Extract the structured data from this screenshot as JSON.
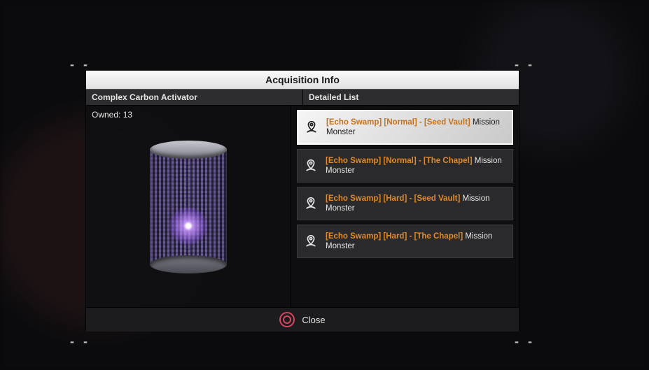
{
  "panel": {
    "title": "Acquisition Info",
    "item_header": "Complex Carbon Activator",
    "list_header": "Detailed List",
    "owned_label": "Owned:",
    "owned_count": 13,
    "close_label": "Close"
  },
  "entries": [
    {
      "location": "[Echo Swamp] [Normal] - [Seed Vault]",
      "suffix": "Mission Monster",
      "selected": true
    },
    {
      "location": "[Echo Swamp] [Normal] - [The Chapel]",
      "suffix": "Mission Monster",
      "selected": false
    },
    {
      "location": "[Echo Swamp] [Hard] - [Seed Vault]",
      "suffix": "Mission Monster",
      "selected": false
    },
    {
      "location": "[Echo Swamp] [Hard] - [The Chapel]",
      "suffix": "Mission Monster",
      "selected": false
    }
  ],
  "colors": {
    "accent": "#e08a2a",
    "close": "#d9455f"
  }
}
